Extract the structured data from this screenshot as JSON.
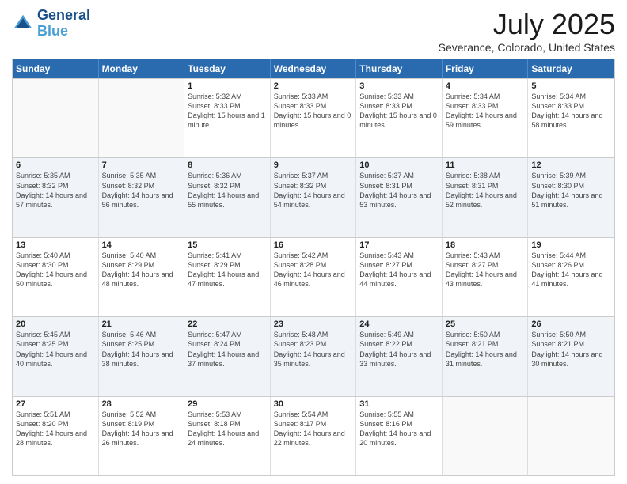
{
  "header": {
    "logo_line1": "General",
    "logo_line2": "Blue",
    "title": "July 2025",
    "subtitle": "Severance, Colorado, United States"
  },
  "days_of_week": [
    "Sunday",
    "Monday",
    "Tuesday",
    "Wednesday",
    "Thursday",
    "Friday",
    "Saturday"
  ],
  "weeks": [
    [
      {
        "day": "",
        "sunrise": "",
        "sunset": "",
        "daylight": "",
        "empty": true
      },
      {
        "day": "",
        "sunrise": "",
        "sunset": "",
        "daylight": "",
        "empty": true
      },
      {
        "day": "1",
        "sunrise": "Sunrise: 5:32 AM",
        "sunset": "Sunset: 8:33 PM",
        "daylight": "Daylight: 15 hours and 1 minute."
      },
      {
        "day": "2",
        "sunrise": "Sunrise: 5:33 AM",
        "sunset": "Sunset: 8:33 PM",
        "daylight": "Daylight: 15 hours and 0 minutes."
      },
      {
        "day": "3",
        "sunrise": "Sunrise: 5:33 AM",
        "sunset": "Sunset: 8:33 PM",
        "daylight": "Daylight: 15 hours and 0 minutes."
      },
      {
        "day": "4",
        "sunrise": "Sunrise: 5:34 AM",
        "sunset": "Sunset: 8:33 PM",
        "daylight": "Daylight: 14 hours and 59 minutes."
      },
      {
        "day": "5",
        "sunrise": "Sunrise: 5:34 AM",
        "sunset": "Sunset: 8:33 PM",
        "daylight": "Daylight: 14 hours and 58 minutes."
      }
    ],
    [
      {
        "day": "6",
        "sunrise": "Sunrise: 5:35 AM",
        "sunset": "Sunset: 8:32 PM",
        "daylight": "Daylight: 14 hours and 57 minutes."
      },
      {
        "day": "7",
        "sunrise": "Sunrise: 5:35 AM",
        "sunset": "Sunset: 8:32 PM",
        "daylight": "Daylight: 14 hours and 56 minutes."
      },
      {
        "day": "8",
        "sunrise": "Sunrise: 5:36 AM",
        "sunset": "Sunset: 8:32 PM",
        "daylight": "Daylight: 14 hours and 55 minutes."
      },
      {
        "day": "9",
        "sunrise": "Sunrise: 5:37 AM",
        "sunset": "Sunset: 8:32 PM",
        "daylight": "Daylight: 14 hours and 54 minutes."
      },
      {
        "day": "10",
        "sunrise": "Sunrise: 5:37 AM",
        "sunset": "Sunset: 8:31 PM",
        "daylight": "Daylight: 14 hours and 53 minutes."
      },
      {
        "day": "11",
        "sunrise": "Sunrise: 5:38 AM",
        "sunset": "Sunset: 8:31 PM",
        "daylight": "Daylight: 14 hours and 52 minutes."
      },
      {
        "day": "12",
        "sunrise": "Sunrise: 5:39 AM",
        "sunset": "Sunset: 8:30 PM",
        "daylight": "Daylight: 14 hours and 51 minutes."
      }
    ],
    [
      {
        "day": "13",
        "sunrise": "Sunrise: 5:40 AM",
        "sunset": "Sunset: 8:30 PM",
        "daylight": "Daylight: 14 hours and 50 minutes."
      },
      {
        "day": "14",
        "sunrise": "Sunrise: 5:40 AM",
        "sunset": "Sunset: 8:29 PM",
        "daylight": "Daylight: 14 hours and 48 minutes."
      },
      {
        "day": "15",
        "sunrise": "Sunrise: 5:41 AM",
        "sunset": "Sunset: 8:29 PM",
        "daylight": "Daylight: 14 hours and 47 minutes."
      },
      {
        "day": "16",
        "sunrise": "Sunrise: 5:42 AM",
        "sunset": "Sunset: 8:28 PM",
        "daylight": "Daylight: 14 hours and 46 minutes."
      },
      {
        "day": "17",
        "sunrise": "Sunrise: 5:43 AM",
        "sunset": "Sunset: 8:27 PM",
        "daylight": "Daylight: 14 hours and 44 minutes."
      },
      {
        "day": "18",
        "sunrise": "Sunrise: 5:43 AM",
        "sunset": "Sunset: 8:27 PM",
        "daylight": "Daylight: 14 hours and 43 minutes."
      },
      {
        "day": "19",
        "sunrise": "Sunrise: 5:44 AM",
        "sunset": "Sunset: 8:26 PM",
        "daylight": "Daylight: 14 hours and 41 minutes."
      }
    ],
    [
      {
        "day": "20",
        "sunrise": "Sunrise: 5:45 AM",
        "sunset": "Sunset: 8:25 PM",
        "daylight": "Daylight: 14 hours and 40 minutes."
      },
      {
        "day": "21",
        "sunrise": "Sunrise: 5:46 AM",
        "sunset": "Sunset: 8:25 PM",
        "daylight": "Daylight: 14 hours and 38 minutes."
      },
      {
        "day": "22",
        "sunrise": "Sunrise: 5:47 AM",
        "sunset": "Sunset: 8:24 PM",
        "daylight": "Daylight: 14 hours and 37 minutes."
      },
      {
        "day": "23",
        "sunrise": "Sunrise: 5:48 AM",
        "sunset": "Sunset: 8:23 PM",
        "daylight": "Daylight: 14 hours and 35 minutes."
      },
      {
        "day": "24",
        "sunrise": "Sunrise: 5:49 AM",
        "sunset": "Sunset: 8:22 PM",
        "daylight": "Daylight: 14 hours and 33 minutes."
      },
      {
        "day": "25",
        "sunrise": "Sunrise: 5:50 AM",
        "sunset": "Sunset: 8:21 PM",
        "daylight": "Daylight: 14 hours and 31 minutes."
      },
      {
        "day": "26",
        "sunrise": "Sunrise: 5:50 AM",
        "sunset": "Sunset: 8:21 PM",
        "daylight": "Daylight: 14 hours and 30 minutes."
      }
    ],
    [
      {
        "day": "27",
        "sunrise": "Sunrise: 5:51 AM",
        "sunset": "Sunset: 8:20 PM",
        "daylight": "Daylight: 14 hours and 28 minutes."
      },
      {
        "day": "28",
        "sunrise": "Sunrise: 5:52 AM",
        "sunset": "Sunset: 8:19 PM",
        "daylight": "Daylight: 14 hours and 26 minutes."
      },
      {
        "day": "29",
        "sunrise": "Sunrise: 5:53 AM",
        "sunset": "Sunset: 8:18 PM",
        "daylight": "Daylight: 14 hours and 24 minutes."
      },
      {
        "day": "30",
        "sunrise": "Sunrise: 5:54 AM",
        "sunset": "Sunset: 8:17 PM",
        "daylight": "Daylight: 14 hours and 22 minutes."
      },
      {
        "day": "31",
        "sunrise": "Sunrise: 5:55 AM",
        "sunset": "Sunset: 8:16 PM",
        "daylight": "Daylight: 14 hours and 20 minutes."
      },
      {
        "day": "",
        "sunrise": "",
        "sunset": "",
        "daylight": "",
        "empty": true
      },
      {
        "day": "",
        "sunrise": "",
        "sunset": "",
        "daylight": "",
        "empty": true
      }
    ]
  ]
}
